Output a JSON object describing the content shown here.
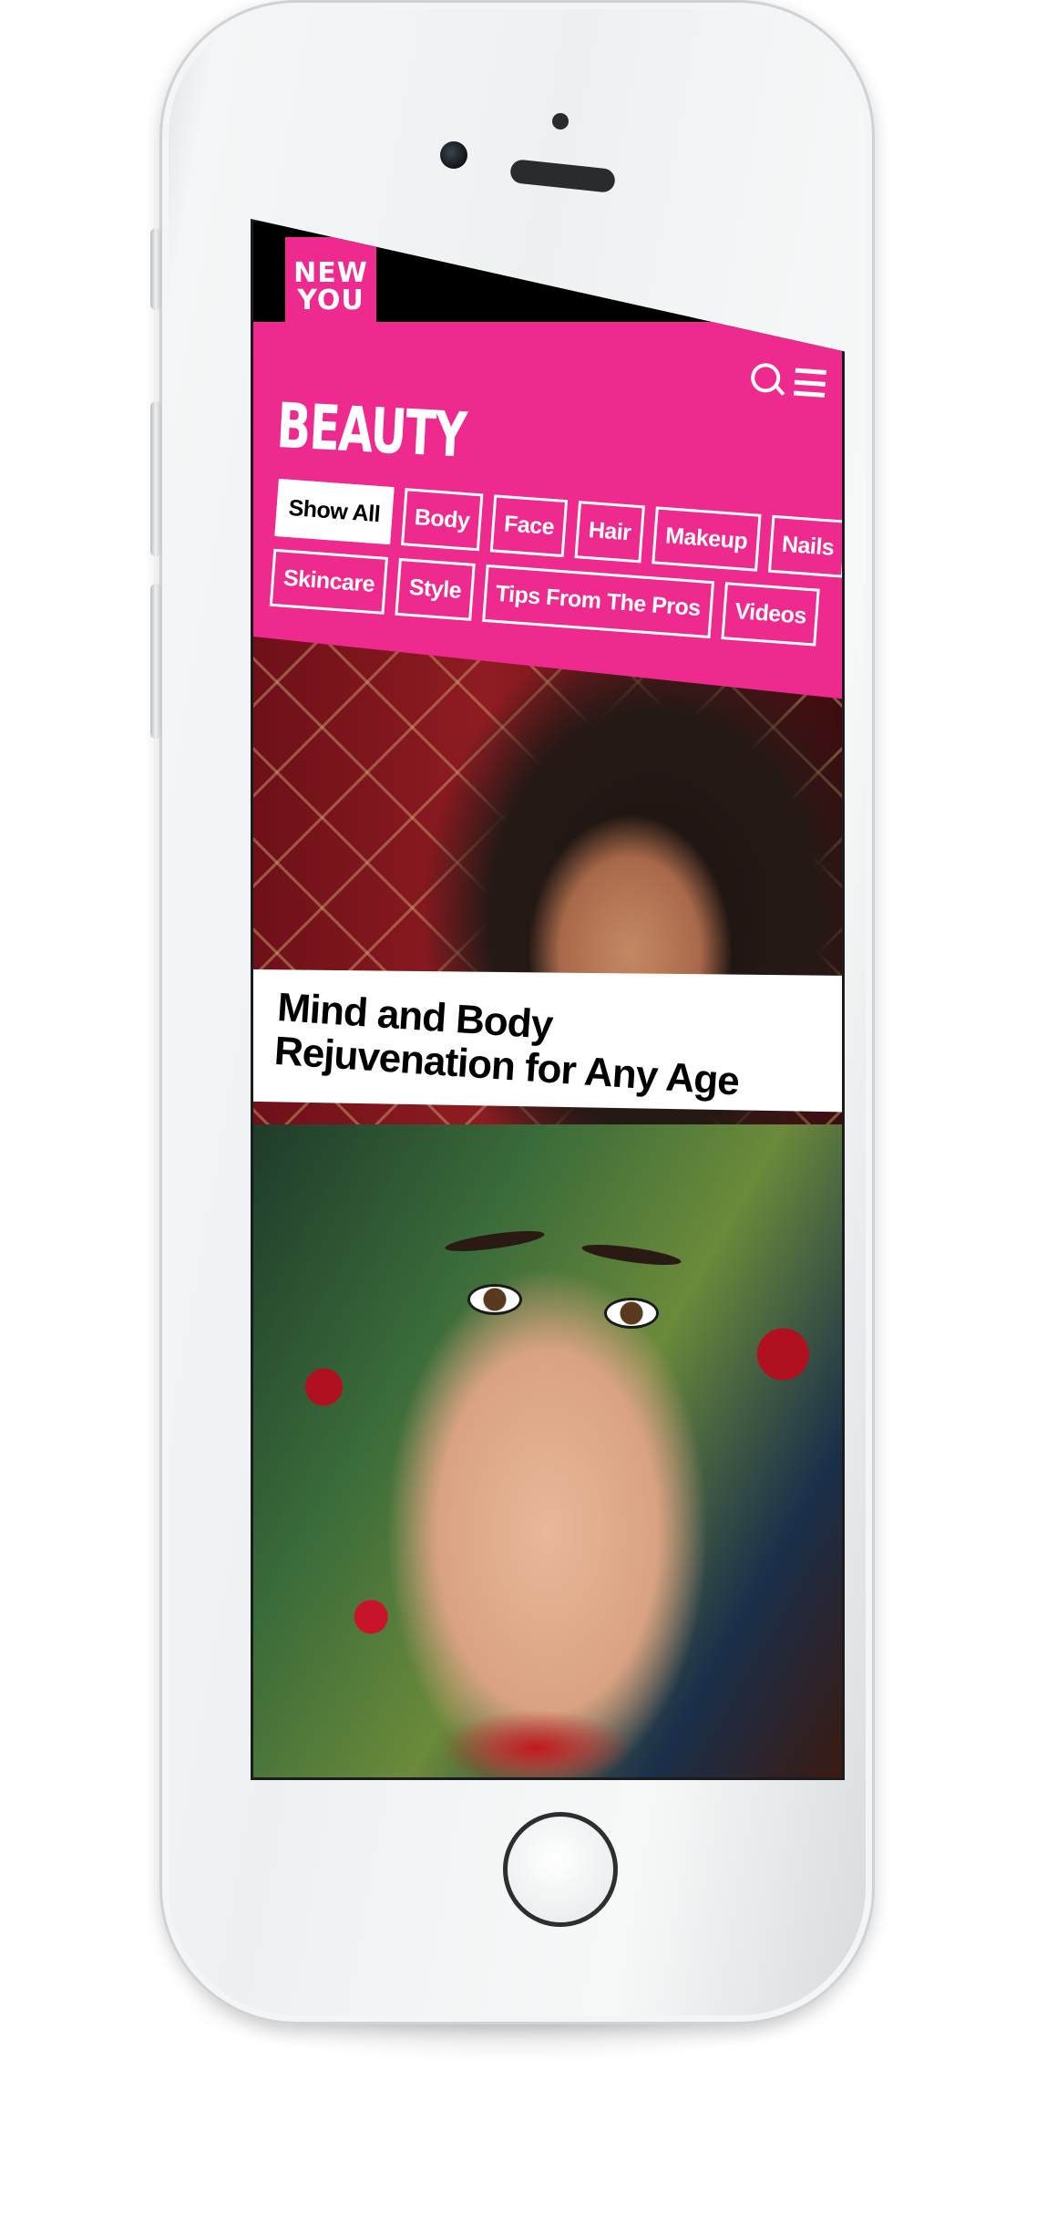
{
  "brand": {
    "logo_line1": "NEW",
    "logo_line2": "YOU",
    "accent_color": "#ee2a8e"
  },
  "header": {
    "title": "BEAUTY",
    "icons": [
      "search-icon",
      "menu-icon"
    ]
  },
  "filters": {
    "row1": [
      "Show All",
      "Body",
      "Face",
      "Hair",
      "Makeup",
      "Nails"
    ],
    "row2": [
      "Skincare",
      "Style",
      "Tips From The Pros",
      "Videos"
    ],
    "active": "Show All"
  },
  "articles": [
    {
      "title": "Mind and Body Rejuvenation for Any Age"
    }
  ]
}
